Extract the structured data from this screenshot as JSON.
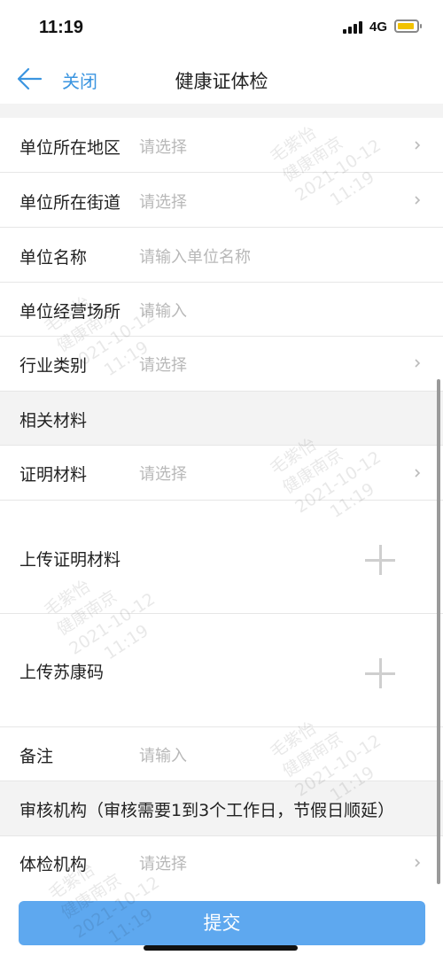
{
  "status_bar": {
    "time": "11:19",
    "network": "4G"
  },
  "nav": {
    "close_label": "关闭",
    "title": "健康证体检"
  },
  "rows": {
    "region": {
      "label": "单位所在地区",
      "value": "请选择"
    },
    "street": {
      "label": "单位所在街道",
      "value": "请选择"
    },
    "unit_name": {
      "label": "单位名称",
      "value": "请输入单位名称"
    },
    "premises": {
      "label": "单位经营场所",
      "value": "请输入"
    },
    "industry": {
      "label": "行业类别",
      "value": "请选择"
    },
    "proof": {
      "label": "证明材料",
      "value": "请选择"
    },
    "upload_proof": {
      "label": "上传证明材料"
    },
    "upload_code": {
      "label": "上传苏康码"
    },
    "remark": {
      "label": "备注",
      "value": "请输入"
    },
    "institution": {
      "label": "体检机构",
      "value": "请选择"
    }
  },
  "sections": {
    "materials": "相关材料",
    "review": "审核机构（审核需要1到3个工作日，节假日顺延）"
  },
  "submit_label": "提交",
  "watermark": {
    "name": "毛紫怡",
    "app": "健康南京",
    "date": "2021-10-12",
    "time": "11:19"
  },
  "colors": {
    "accent": "#3b95e0",
    "button": "#5ea8ef"
  }
}
